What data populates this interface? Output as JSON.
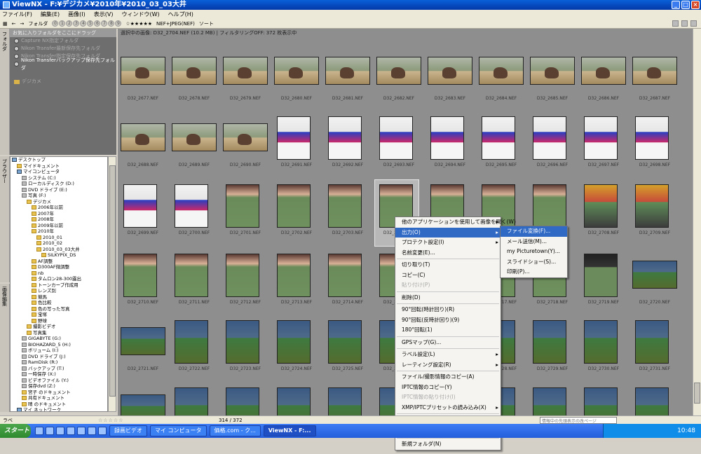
{
  "window": {
    "title": "ViewNX - F:¥デジカメ¥2010年¥2010_03_03大井"
  },
  "menubar": {
    "items": [
      "ファイル(F)",
      "編集(E)",
      "画像(I)",
      "表示(V)",
      "ウィンドウ(W)",
      "ヘルプ(H)"
    ]
  },
  "toolbar": {
    "folder_label": "フォルダ",
    "label_dots": [
      "0",
      "1",
      "2",
      "3",
      "4",
      "5",
      "6",
      "7",
      "8",
      "9"
    ],
    "rating": "☆★★★★★",
    "format": "NEF+JPEG(NEF)",
    "sort": "ソート"
  },
  "favorites": {
    "strip_label": "フォルダ",
    "header": "お気に入りフォルダをここにドラッグ",
    "items": [
      {
        "label": "Capture NX指定フォルダ",
        "dim": true
      },
      {
        "label": "Nikon Transfer最新保存先フォルダ",
        "dim": true
      },
      {
        "label": "Nikon Transfer指定保存先フォルダ",
        "dim": true
      },
      {
        "label": "Nikon Transferバックアップ保存先フォルダ",
        "dim": false
      }
    ],
    "extra": "デジカメ"
  },
  "tree": {
    "strip_label": "ブラウザー",
    "rows": [
      {
        "label": "デスクトップ",
        "indent": 0,
        "type": "pc"
      },
      {
        "label": "マイドキュメント",
        "indent": 1,
        "type": "f"
      },
      {
        "label": "マイコンピュータ",
        "indent": 1,
        "type": "pc"
      },
      {
        "label": "システム (C:)",
        "indent": 2,
        "type": "drv"
      },
      {
        "label": "ローカルディスク (D:)",
        "indent": 2,
        "type": "drv"
      },
      {
        "label": "DVD ドライブ (E:)",
        "indent": 2,
        "type": "drv"
      },
      {
        "label": "写真 (F:)",
        "indent": 2,
        "type": "drv"
      },
      {
        "label": "デジカメ",
        "indent": 3,
        "type": "f"
      },
      {
        "label": "2006年以前",
        "indent": 4,
        "type": "f"
      },
      {
        "label": "2007年",
        "indent": 4,
        "type": "f"
      },
      {
        "label": "2008年",
        "indent": 4,
        "type": "f"
      },
      {
        "label": "2009年以前",
        "indent": 4,
        "type": "f"
      },
      {
        "label": "2010年",
        "indent": 4,
        "type": "f"
      },
      {
        "label": "2010_01",
        "indent": 5,
        "type": "f"
      },
      {
        "label": "2010_02",
        "indent": 5,
        "type": "f"
      },
      {
        "label": "2010_03_03大井",
        "indent": 5,
        "type": "f"
      },
      {
        "label": "SILKYPIX_DS",
        "indent": 6,
        "type": "f"
      },
      {
        "label": "AF調整",
        "indent": 4,
        "type": "f"
      },
      {
        "label": "D300AF微調整",
        "indent": 4,
        "type": "f"
      },
      {
        "label": "nb",
        "indent": 4,
        "type": "f"
      },
      {
        "label": "タムロン28-300露出",
        "indent": 4,
        "type": "f"
      },
      {
        "label": "トーンカーブ作成用",
        "indent": 4,
        "type": "f"
      },
      {
        "label": "レンズ別",
        "indent": 4,
        "type": "f"
      },
      {
        "label": "競馬",
        "indent": 4,
        "type": "f"
      },
      {
        "label": "色比較",
        "indent": 4,
        "type": "f"
      },
      {
        "label": "色の写った写真",
        "indent": 4,
        "type": "f"
      },
      {
        "label": "宝塚",
        "indent": 4,
        "type": "f"
      },
      {
        "label": "野球",
        "indent": 4,
        "type": "f"
      },
      {
        "label": "撮影ビデオ",
        "indent": 3,
        "type": "f"
      },
      {
        "label": "写真集",
        "indent": 3,
        "type": "f"
      },
      {
        "label": "GIGABYTE (G:)",
        "indent": 2,
        "type": "drv"
      },
      {
        "label": "BIOHAZARD_5 (H:)",
        "indent": 2,
        "type": "drv"
      },
      {
        "label": "ボリューム (I:)",
        "indent": 2,
        "type": "drv"
      },
      {
        "label": "DVD ドライブ (J:)",
        "indent": 2,
        "type": "drv"
      },
      {
        "label": "RamDisk (R:)",
        "indent": 2,
        "type": "drv"
      },
      {
        "label": "バックアップ (T:)",
        "indent": 2,
        "type": "drv"
      },
      {
        "label": "一時保存 (X:)",
        "indent": 2,
        "type": "drv"
      },
      {
        "label": "ビデオファイル (Y:)",
        "indent": 2,
        "type": "drv"
      },
      {
        "label": "保存dvd (Z:)",
        "indent": 2,
        "type": "drv"
      },
      {
        "label": "宮子 のドキュメント",
        "indent": 2,
        "type": "f"
      },
      {
        "label": "共有ドキュメント",
        "indent": 2,
        "type": "f"
      },
      {
        "label": "晴 のドキュメント",
        "indent": 2,
        "type": "f"
      },
      {
        "label": "マイ ネットワーク",
        "indent": 1,
        "type": "pc"
      },
      {
        "label": "dvd",
        "indent": 1,
        "type": "f"
      }
    ]
  },
  "metadata_strip": "画像編集",
  "infobar": "選択中の画像: D32_2704.NEF (10.2 MB) | フィルタリングOFF: 372 枚表示中",
  "rows": [
    {
      "type": "race",
      "names": [
        "D32_2677.NEF",
        "D32_2678.NEF",
        "D32_2679.NEF",
        "D32_2680.NEF",
        "D32_2681.NEF",
        "D32_2682.NEF",
        "D32_2683.NEF",
        "D32_2684.NEF",
        "D32_2685.NEF",
        "D32_2686.NEF",
        "D32_2687.NEF"
      ]
    },
    {
      "type": "mix2",
      "names": [
        "D32_2688.NEF",
        "D32_2689.NEF",
        "D32_2690.NEF",
        "D32_2691.NEF",
        "D32_2692.NEF",
        "D32_2693.NEF",
        "D32_2694.NEF",
        "D32_2695.NEF",
        "D32_2696.NEF",
        "D32_2697.NEF",
        "D32_2698.NEF"
      ]
    },
    {
      "type": "mix3",
      "names": [
        "D32_2699.NEF",
        "D32_2700.NEF",
        "D32_2701.NEF",
        "D32_2702.NEF",
        "D32_2703.NEF",
        "D32_2704.NEF",
        "D32_2705.NEF",
        "D32_2706.NEF",
        "D32_2707.NEF",
        "D32_2708.NEF",
        "D32_2709.NEF"
      ]
    },
    {
      "type": "girl",
      "names": [
        "D32_2710.NEF",
        "D32_2711.NEF",
        "D32_2712.NEF",
        "D32_2713.NEF",
        "D32_2714.NEF",
        "D32_2715.NEF",
        "D32_2716.NEF",
        "D32_2717.NEF",
        "D32_2718.NEF",
        "D32_2719.NEF",
        "D32_2720.NEF"
      ]
    },
    {
      "type": "track",
      "names": [
        "D32_2721.NEF",
        "D32_2722.NEF",
        "D32_2723.NEF",
        "D32_2724.NEF",
        "D32_2725.NEF",
        "D32_2726.NEF",
        "D32_2727.NEF",
        "D32_2728.NEF",
        "D32_2729.NEF",
        "D32_2730.NEF",
        "D32_2731.NEF"
      ]
    },
    {
      "type": "track",
      "names": [
        "",
        "",
        "",
        "",
        "",
        "",
        "",
        "",
        "",
        "",
        ""
      ]
    }
  ],
  "context_menu": {
    "items": [
      {
        "label": "他のアプリケーションを使用して画像を開く(W)",
        "arrow": true
      },
      {
        "label": "出力(O)",
        "arrow": true,
        "hl": true
      },
      {
        "label": "プロテクト設定(I)",
        "arrow": true
      },
      {
        "label": "名前変更(E)..."
      },
      {
        "sep": true
      },
      {
        "label": "切り取り(T)"
      },
      {
        "label": "コピー(C)"
      },
      {
        "label": "貼り付け(P)",
        "dis": true
      },
      {
        "sep": true
      },
      {
        "label": "削除(D)"
      },
      {
        "sep": true
      },
      {
        "label": "90°回転(時計回り)(R)"
      },
      {
        "label": "90°回転(反時計回り)(9)"
      },
      {
        "label": "180°回転(1)"
      },
      {
        "sep": true
      },
      {
        "label": "GPSマップ(G)..."
      },
      {
        "sep": true
      },
      {
        "label": "ラベル設定(L)",
        "arrow": true
      },
      {
        "label": "レーティング設定(R)",
        "arrow": true
      },
      {
        "sep": true
      },
      {
        "label": "ファイル/撮影情報のコピー(A)"
      },
      {
        "label": "IPTC情報のコピー(Y)"
      },
      {
        "label": "IPTC情報の貼り付け(I)",
        "dis": true
      },
      {
        "label": "XMP/IPTCプリセットの読み込み(X)",
        "arrow": true
      },
      {
        "sep": true
      },
      {
        "label": "音声メモ(V)",
        "dis": true,
        "arrow": true
      },
      {
        "sep": true
      },
      {
        "label": "編集前に戻す(S)...",
        "dis": true
      },
      {
        "sep": true
      },
      {
        "label": "新規フォルダ(N)"
      }
    ]
  },
  "submenu": {
    "items": [
      "ファイル変換(F)...",
      "メール送信(M)...",
      "my Picturetown(Y)...",
      "スライドショー(S)...",
      "印刷(P)..."
    ]
  },
  "statusbar": {
    "left": "ラベ",
    "count": "314 / 372",
    "stars": "☆☆☆☆☆",
    "field": "情報中の先頭表示の改ページ"
  },
  "taskbar": {
    "start": "スタート",
    "tasks": [
      "録画ビデオ",
      "マイ コンピュータ",
      "価格.com - ク...",
      "ViewNX - F:..."
    ],
    "clock": "10:48"
  }
}
